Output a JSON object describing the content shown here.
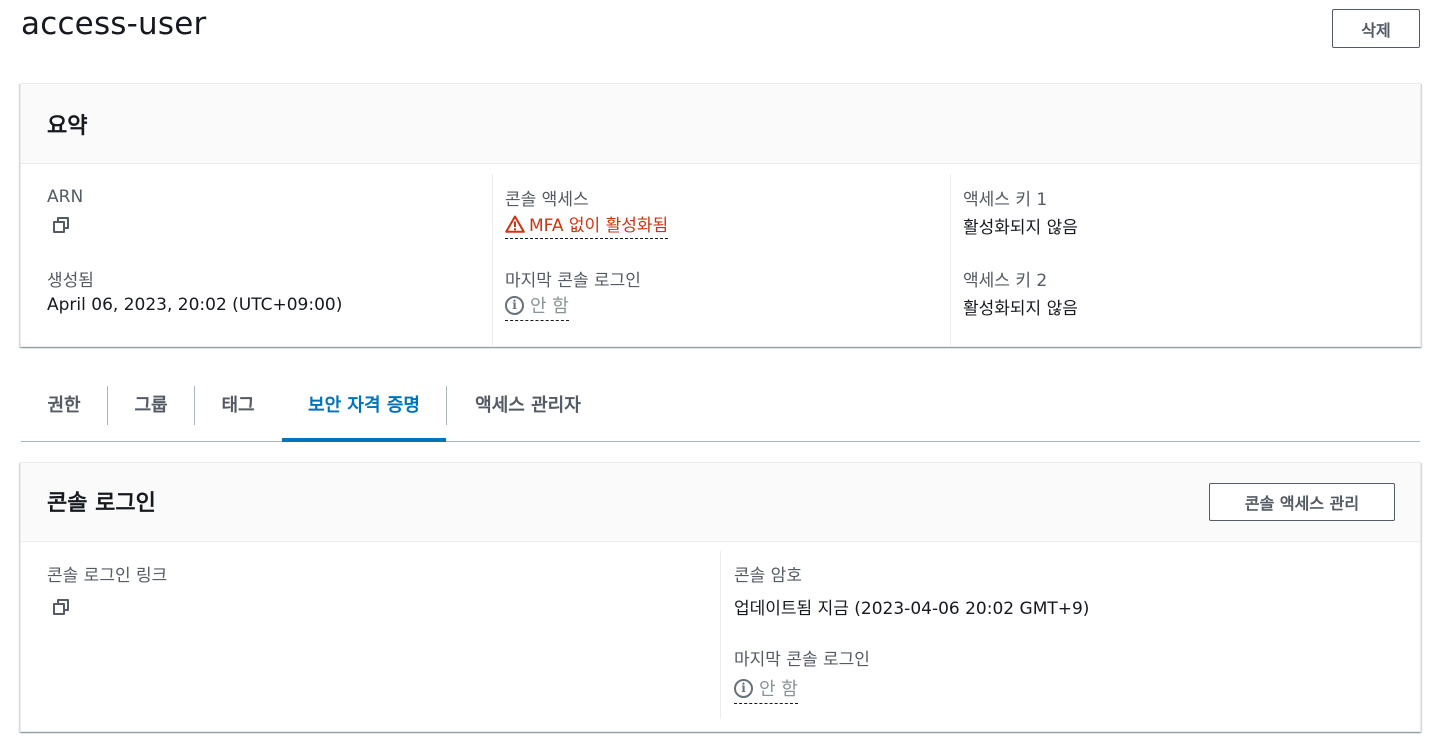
{
  "page": {
    "title": "access-user",
    "delete_label": "삭제"
  },
  "summary": {
    "title": "요약",
    "arn_label": "ARN",
    "created_label": "생성됨",
    "created_value": "April 06, 2023, 20:02 (UTC+09:00)",
    "console_access_label": "콘솔 액세스",
    "console_access_value": "MFA 없이 활성화됨",
    "last_login_label": "마지막 콘솔 로그인",
    "last_login_value": "안 함",
    "access_key1_label": "액세스 키 1",
    "access_key1_value": "활성화되지 않음",
    "access_key2_label": "액세스 키 2",
    "access_key2_value": "활성화되지 않음"
  },
  "tabs": [
    {
      "label": "권한"
    },
    {
      "label": "그룹"
    },
    {
      "label": "태그"
    },
    {
      "label": "보안 자격 증명"
    },
    {
      "label": "액세스 관리자"
    }
  ],
  "console_login": {
    "title": "콘솔 로그인",
    "manage_label": "콘솔 액세스 관리",
    "link_label": "콘솔 로그인 링크",
    "password_label": "콘솔 암호",
    "password_value": "업데이트됨 지금 (2023-04-06 20:02 GMT+9)",
    "last_login_label": "마지막 콘솔 로그인",
    "last_login_value": "안 함"
  },
  "colors": {
    "accent": "#0073bb",
    "warning": "#d13212",
    "muted": "#545b64"
  },
  "icons": {
    "copy": "copy-icon",
    "warning": "warning-icon",
    "info": "info-icon"
  }
}
